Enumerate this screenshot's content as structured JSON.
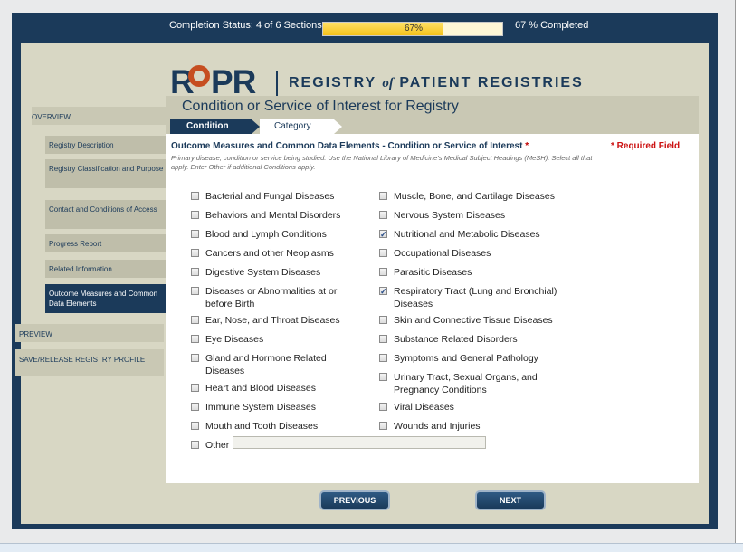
{
  "status": {
    "completion_text": "Completion Status: 4 of 6 Sections",
    "progress_fraction": 0.67,
    "progress_label": "67%",
    "completed_text": "67 % Completed"
  },
  "logo": {
    "letters_left": "R",
    "letters_right": "PR",
    "tagline_part1": "REGISTRY",
    "tagline_of": "of",
    "tagline_part2": "PATIENT REGISTRIES"
  },
  "sidebar": {
    "overview": "OVERVIEW",
    "items": [
      {
        "label": "Registry Description"
      },
      {
        "label": "Registry Classification and Purpose"
      },
      {
        "label": "Contact and Conditions of Access"
      },
      {
        "label": "Progress Report"
      },
      {
        "label": "Related Information"
      },
      {
        "label": "Outcome Measures and Common Data Elements"
      }
    ],
    "preview": "PREVIEW",
    "save_release": "SAVE/RELEASE REGISTRY PROFILE"
  },
  "main": {
    "title": "Condition or Service of Interest for Registry",
    "crumb_current": "Condition",
    "crumb_next": "Category",
    "question": "Outcome Measures and Common Data Elements - Condition or Service of Interest",
    "required_star": "*",
    "required_note": "* Required Field",
    "help": "Primary disease, condition or service being studied. Use the National Library of Medicine's Medical Subject Headings (MeSH). Select all that apply. Enter Other if additional Conditions apply.",
    "left_options": [
      {
        "label": "Bacterial and Fungal Diseases",
        "checked": false
      },
      {
        "label": "Behaviors and Mental Disorders",
        "checked": false
      },
      {
        "label": "Blood and Lymph Conditions",
        "checked": false
      },
      {
        "label": "Cancers and other Neoplasms",
        "checked": false
      },
      {
        "label": "Digestive System Diseases",
        "checked": false
      },
      {
        "label": "Diseases or Abnormalities at or before Birth",
        "checked": false
      },
      {
        "label": "Ear, Nose, and Throat Diseases",
        "checked": false
      },
      {
        "label": "Eye Diseases",
        "checked": false
      },
      {
        "label": "Gland and Hormone Related Diseases",
        "checked": false
      },
      {
        "label": "Heart and Blood Diseases",
        "checked": false
      },
      {
        "label": "Immune System Diseases",
        "checked": false
      },
      {
        "label": "Mouth and Tooth Diseases",
        "checked": false
      },
      {
        "label": "Other",
        "checked": false
      }
    ],
    "right_options": [
      {
        "label": "Muscle, Bone, and Cartilage Diseases",
        "checked": false
      },
      {
        "label": "Nervous System Diseases",
        "checked": false
      },
      {
        "label": "Nutritional and Metabolic Diseases",
        "checked": true
      },
      {
        "label": "Occupational Diseases",
        "checked": false
      },
      {
        "label": "Parasitic Diseases",
        "checked": false
      },
      {
        "label": "Respiratory Tract (Lung and Bronchial) Diseases",
        "checked": true
      },
      {
        "label": "Skin and Connective Tissue Diseases",
        "checked": false
      },
      {
        "label": "Substance Related Disorders",
        "checked": false
      },
      {
        "label": "Symptoms and General Pathology",
        "checked": false
      },
      {
        "label": "Urinary Tract, Sexual Organs, and Pregnancy Conditions",
        "checked": false
      },
      {
        "label": "Viral Diseases",
        "checked": false
      },
      {
        "label": "Wounds and Injuries",
        "checked": false
      }
    ],
    "other_value": "",
    "previous_label": "PREVIOUS",
    "next_label": "NEXT"
  }
}
